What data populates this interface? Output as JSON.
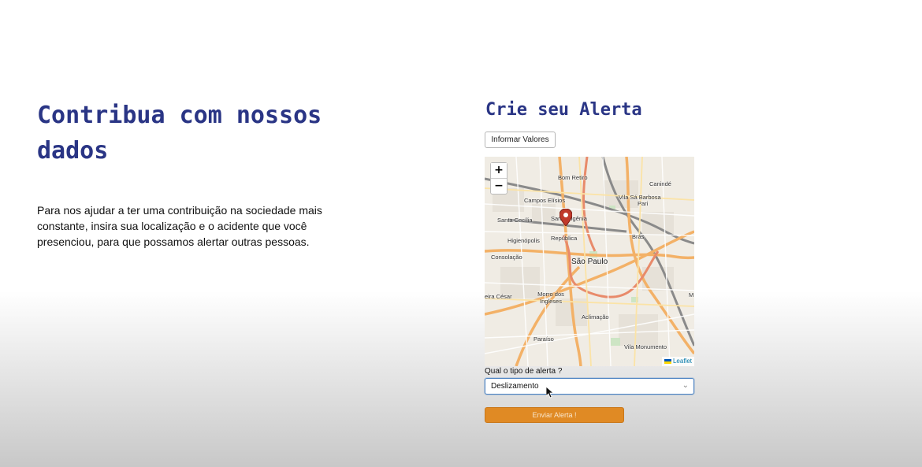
{
  "left": {
    "title": "Contribua com nossos dados",
    "description": "Para nos ajudar a ter uma contribuição na sociedade mais constante, insira sua localização e o acidente que você presenciou, para que possamos alertar outras pessoas."
  },
  "right": {
    "title": "Crie seu Alerta",
    "info_button": "Informar Valores",
    "map": {
      "zoom_in": "+",
      "zoom_out": "−",
      "attribution": "Leaflet",
      "labels": {
        "bom_retiro": "Bom Retiro",
        "caninde": "Canindé",
        "vila_sa_barbosa": "Vila Sá Barbosa",
        "pari": "Pari",
        "campos_eliseos": "Campos Elísios",
        "santa_cecilia": "Santa Cecília",
        "santa_ifigenia": "Santa Ifigênia",
        "higienopolis": "Higienópolis",
        "republica": "República",
        "bras": "Brás",
        "consolacao": "Consolação",
        "sao_paulo": "São Paulo",
        "morro_dos_ingleses": "Morro dos Ingleses",
        "cesar": "eira César",
        "aclimacao": "Aclimação",
        "paraiso": "Paraíso",
        "vila_monumento": "Vila Monumento",
        "m": "M"
      }
    },
    "alert_label": "Qual o tipo de alerta ?",
    "alert_select": {
      "selected": "Deslizamento"
    },
    "send_button": "Enviar Alerta !"
  },
  "colors": {
    "heading": "#2a3585",
    "send_button": "#e08a24",
    "marker": "#c0392b"
  },
  "icons": {
    "marker": "map-marker-icon",
    "cursor": "mouse-pointer-icon",
    "caret": "chevron-down-icon"
  }
}
